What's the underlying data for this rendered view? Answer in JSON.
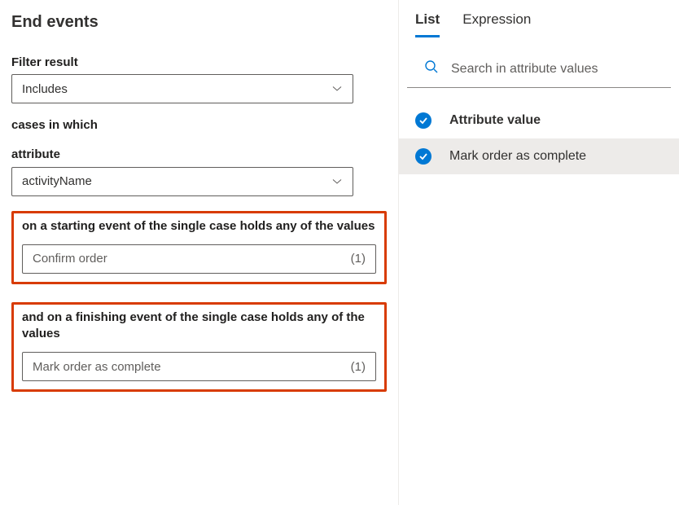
{
  "header": {
    "title": "End events"
  },
  "filter": {
    "label": "Filter result",
    "value": "Includes"
  },
  "cases_label": "cases in which",
  "attribute": {
    "label": "attribute",
    "value": "activityName"
  },
  "starting": {
    "label": "on a starting event of the single case holds any of the values",
    "value": "Confirm order",
    "count": "(1)"
  },
  "finishing": {
    "label": "and on a finishing event of the single case holds any of the values",
    "value": "Mark order as complete",
    "count": "(1)"
  },
  "tabs": {
    "list": "List",
    "expression": "Expression"
  },
  "search": {
    "placeholder": "Search in attribute values"
  },
  "attr_list": {
    "header": "Attribute value",
    "items": [
      {
        "label": "Mark order as complete",
        "checked": true,
        "selected": true
      }
    ]
  }
}
